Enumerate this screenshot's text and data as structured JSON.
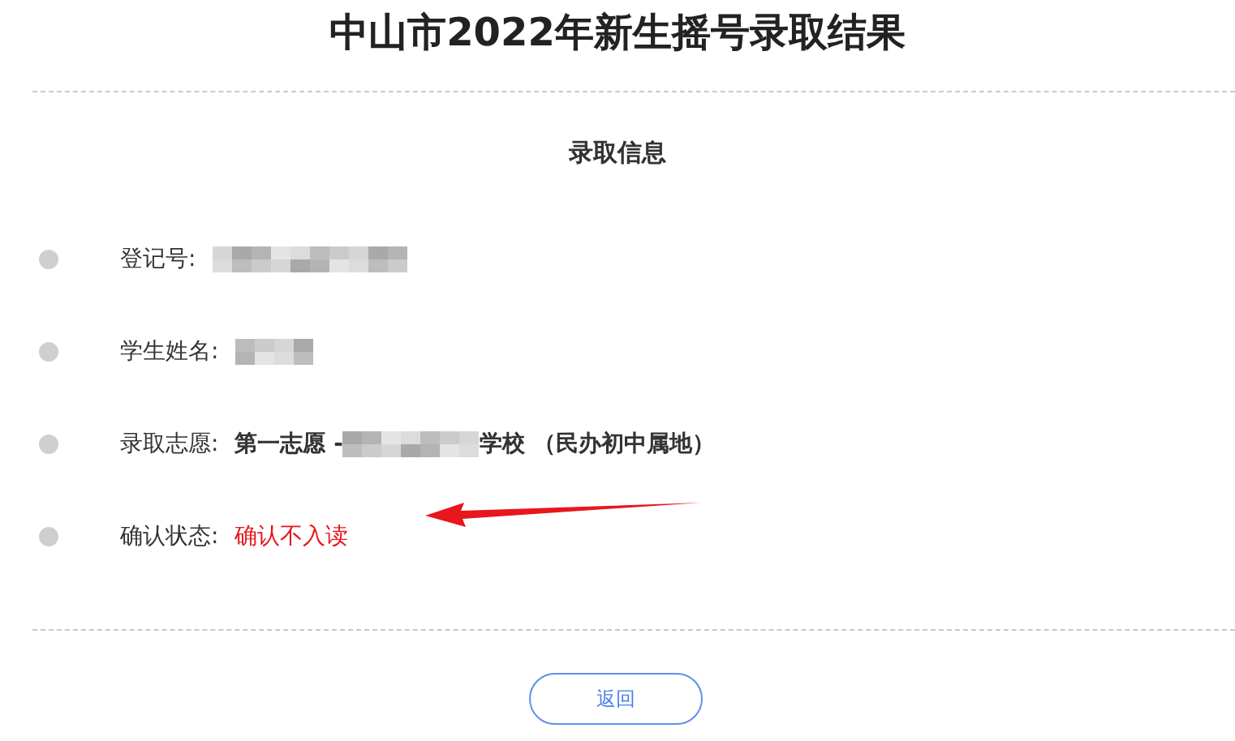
{
  "title": "中山市2022年新生摇号录取结果",
  "section_title": "录取信息",
  "fields": [
    {
      "label": "登记号:",
      "value": [
        {
          "kind": "mosaiclong"
        }
      ]
    },
    {
      "label": "学生姓名:",
      "value": [
        {
          "kind": "mosaicshort"
        }
      ]
    },
    {
      "label": "录取志愿:",
      "value": [
        {
          "kind": "text",
          "text": "第一志愿 - ",
          "bold": true
        },
        {
          "kind": "mosaicmedium"
        },
        {
          "kind": "text",
          "text": "学校 （民办初中属地）",
          "bold": true
        }
      ]
    },
    {
      "label": "确认状态:",
      "value": [
        {
          "kind": "status",
          "text": "确认不入读"
        }
      ]
    }
  ],
  "back_button": "返回"
}
